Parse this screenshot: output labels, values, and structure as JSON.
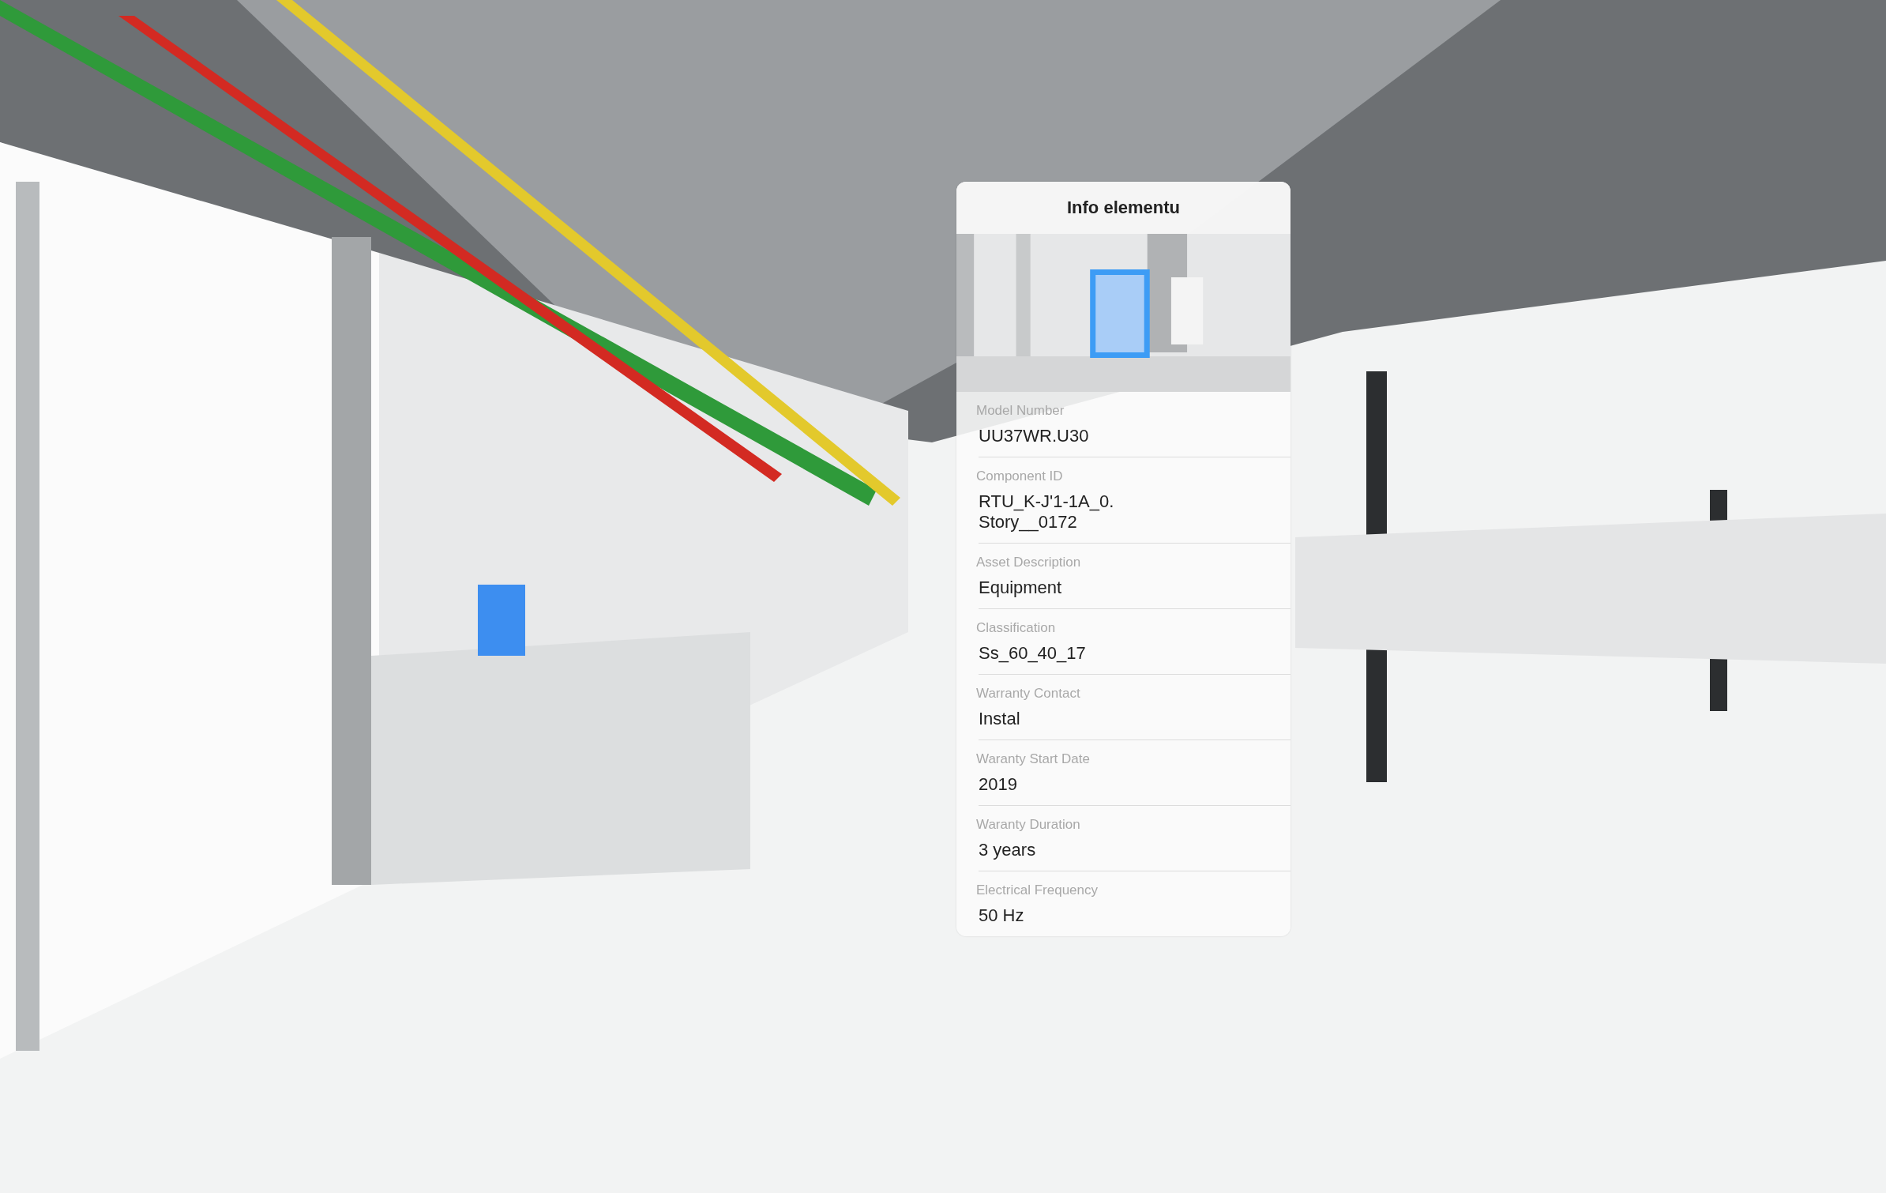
{
  "panel": {
    "title": "Info elementu",
    "properties": [
      {
        "label": "Model Number",
        "value": "UU37WR.U30"
      },
      {
        "label": "Component ID",
        "value": "RTU_K-J'1-1A_0.\nStory__0172"
      },
      {
        "label": "Asset Description",
        "value": "Equipment"
      },
      {
        "label": "Classification",
        "value": "Ss_60_40_17"
      },
      {
        "label": "Warranty Contact",
        "value": "Instal"
      },
      {
        "label": "Waranty Start Date",
        "value": "2019"
      },
      {
        "label": "Waranty Duration",
        "value": "3 years"
      },
      {
        "label": "Electrical Frequency",
        "value": "50 Hz"
      }
    ]
  }
}
